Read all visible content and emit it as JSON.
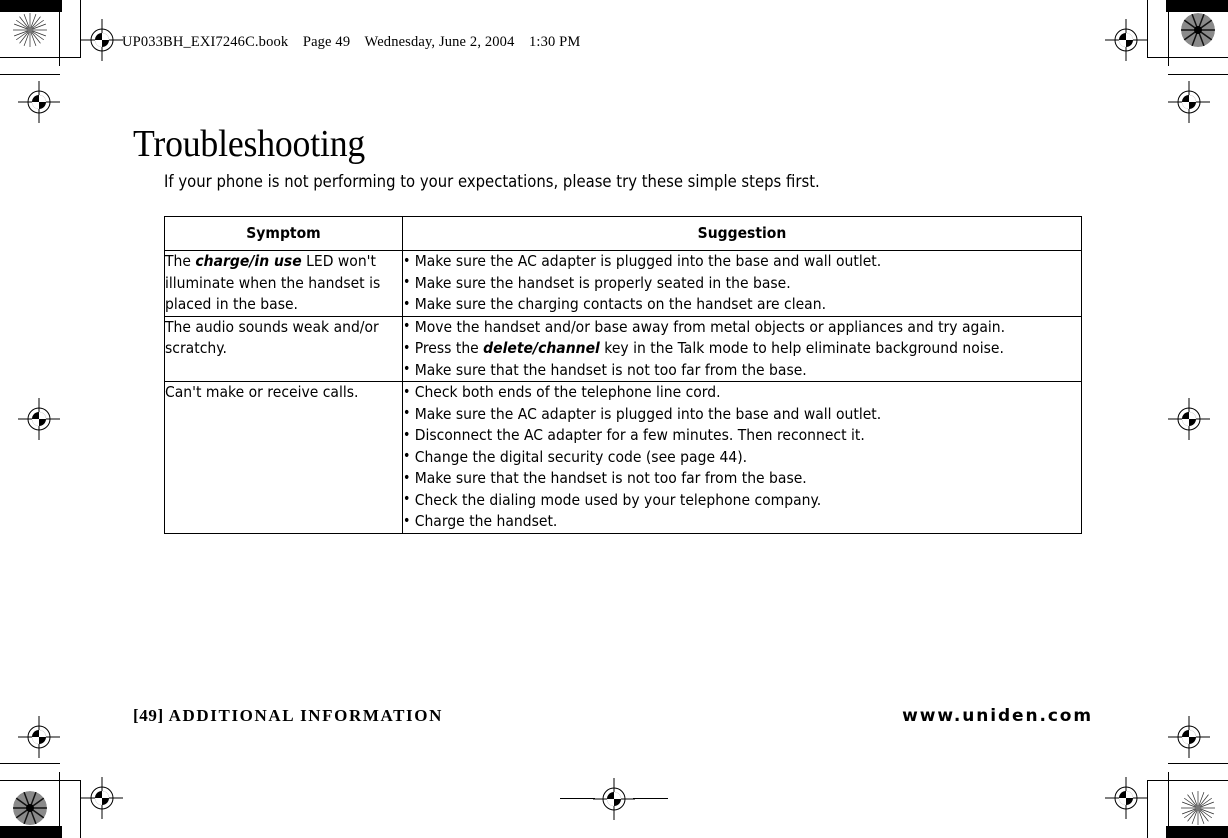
{
  "page_header": {
    "filename": "UP033BH_EXI7246C.book",
    "page_label": "Page 49",
    "weekday_date": "Wednesday, June 2, 2004",
    "time": "1:30 PM"
  },
  "title": "Troubleshooting",
  "intro": "If your phone is not performing to your expectations, please try these simple steps first.",
  "table": {
    "headers": {
      "symptom": "Symptom",
      "suggestion": "Suggestion"
    },
    "rows": [
      {
        "symptom_prefix": "The ",
        "symptom_emphasis": "charge/in use",
        "symptom_suffix": " LED won't illuminate when the handset is placed in the base.",
        "suggestions": [
          {
            "text": "Make sure the AC adapter is plugged into the base and wall outlet."
          },
          {
            "text": "Make sure the handset is properly seated in the base."
          },
          {
            "text": "Make sure the charging contacts on the handset are clean."
          }
        ]
      },
      {
        "symptom_prefix": "The audio sounds weak and/or scratchy.",
        "symptom_emphasis": "",
        "symptom_suffix": "",
        "suggestions": [
          {
            "text": "Move the handset and/or base away from metal objects or appliances and try again."
          },
          {
            "prefix": "Press the ",
            "emphasis": "delete/channel",
            "suffix": " key in the Talk mode to help eliminate background noise."
          },
          {
            "text": "Make sure that the handset is not too far from the base."
          }
        ]
      },
      {
        "symptom_prefix": "Can't make or receive calls.",
        "symptom_emphasis": "",
        "symptom_suffix": "",
        "suggestions": [
          {
            "text": "Check both ends of the telephone line cord."
          },
          {
            "text": "Make sure the AC adapter is plugged into the base and wall outlet."
          },
          {
            "text": "Disconnect the AC adapter for a few minutes. Then reconnect it."
          },
          {
            "text": "Change the digital security code (see page 44)."
          },
          {
            "text": "Make sure that the handset is not too far from the base."
          },
          {
            "text": "Check the dialing mode used by your telephone company."
          },
          {
            "text": "Charge the handset."
          }
        ]
      }
    ]
  },
  "footer": {
    "page_number": "[49]",
    "section": "ADDITIONAL INFORMATION",
    "website": "www.uniden.com"
  },
  "colors": {
    "ink": "#000000",
    "paper": "#ffffff"
  }
}
